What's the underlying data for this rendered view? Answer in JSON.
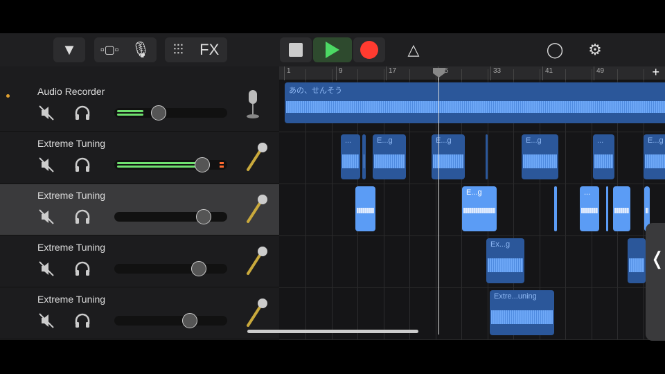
{
  "toolbar": {
    "fx_label": "FX",
    "icons": [
      "browser-dropdown-icon",
      "tracks-view-icon",
      "microphone-icon",
      "mixer-icon",
      "fx",
      "stop-icon",
      "play-icon",
      "record-icon",
      "metronome-icon",
      "loop-icon",
      "settings-icon"
    ],
    "play_color": "#4cd964",
    "record_color": "#ff3b30"
  },
  "ruler": {
    "bars": [
      "1",
      "9",
      "17",
      "25",
      "33",
      "41",
      "49"
    ],
    "add_label": "+"
  },
  "tracks": [
    {
      "name": "Audio Recorder",
      "volume": 0.39,
      "instrument": "studio-microphone",
      "selected": false,
      "meter": 0.25
    },
    {
      "name": "Extreme Tuning",
      "volume": 0.78,
      "instrument": "handheld-microphone",
      "selected": false,
      "meter": 0.8
    },
    {
      "name": "Extreme Tuning",
      "volume": 0.79,
      "instrument": "handheld-microphone",
      "selected": true,
      "meter": 0
    },
    {
      "name": "Extreme Tuning",
      "volume": 0.75,
      "instrument": "handheld-microphone",
      "selected": false,
      "meter": 0
    },
    {
      "name": "Extreme Tuning",
      "volume": 0.67,
      "instrument": "handheld-microphone",
      "selected": false,
      "meter": 0
    }
  ],
  "regions": [
    [
      "あの、せんそう"
    ],
    [
      "...",
      "",
      "E...g",
      "E...g",
      "",
      "E...g",
      "...",
      "E...g"
    ],
    [
      "",
      "E...g",
      "",
      "...",
      "",
      "",
      ""
    ],
    [
      "Ex...g",
      ""
    ],
    [
      "Extre...uning"
    ]
  ],
  "side_handle": "❬"
}
